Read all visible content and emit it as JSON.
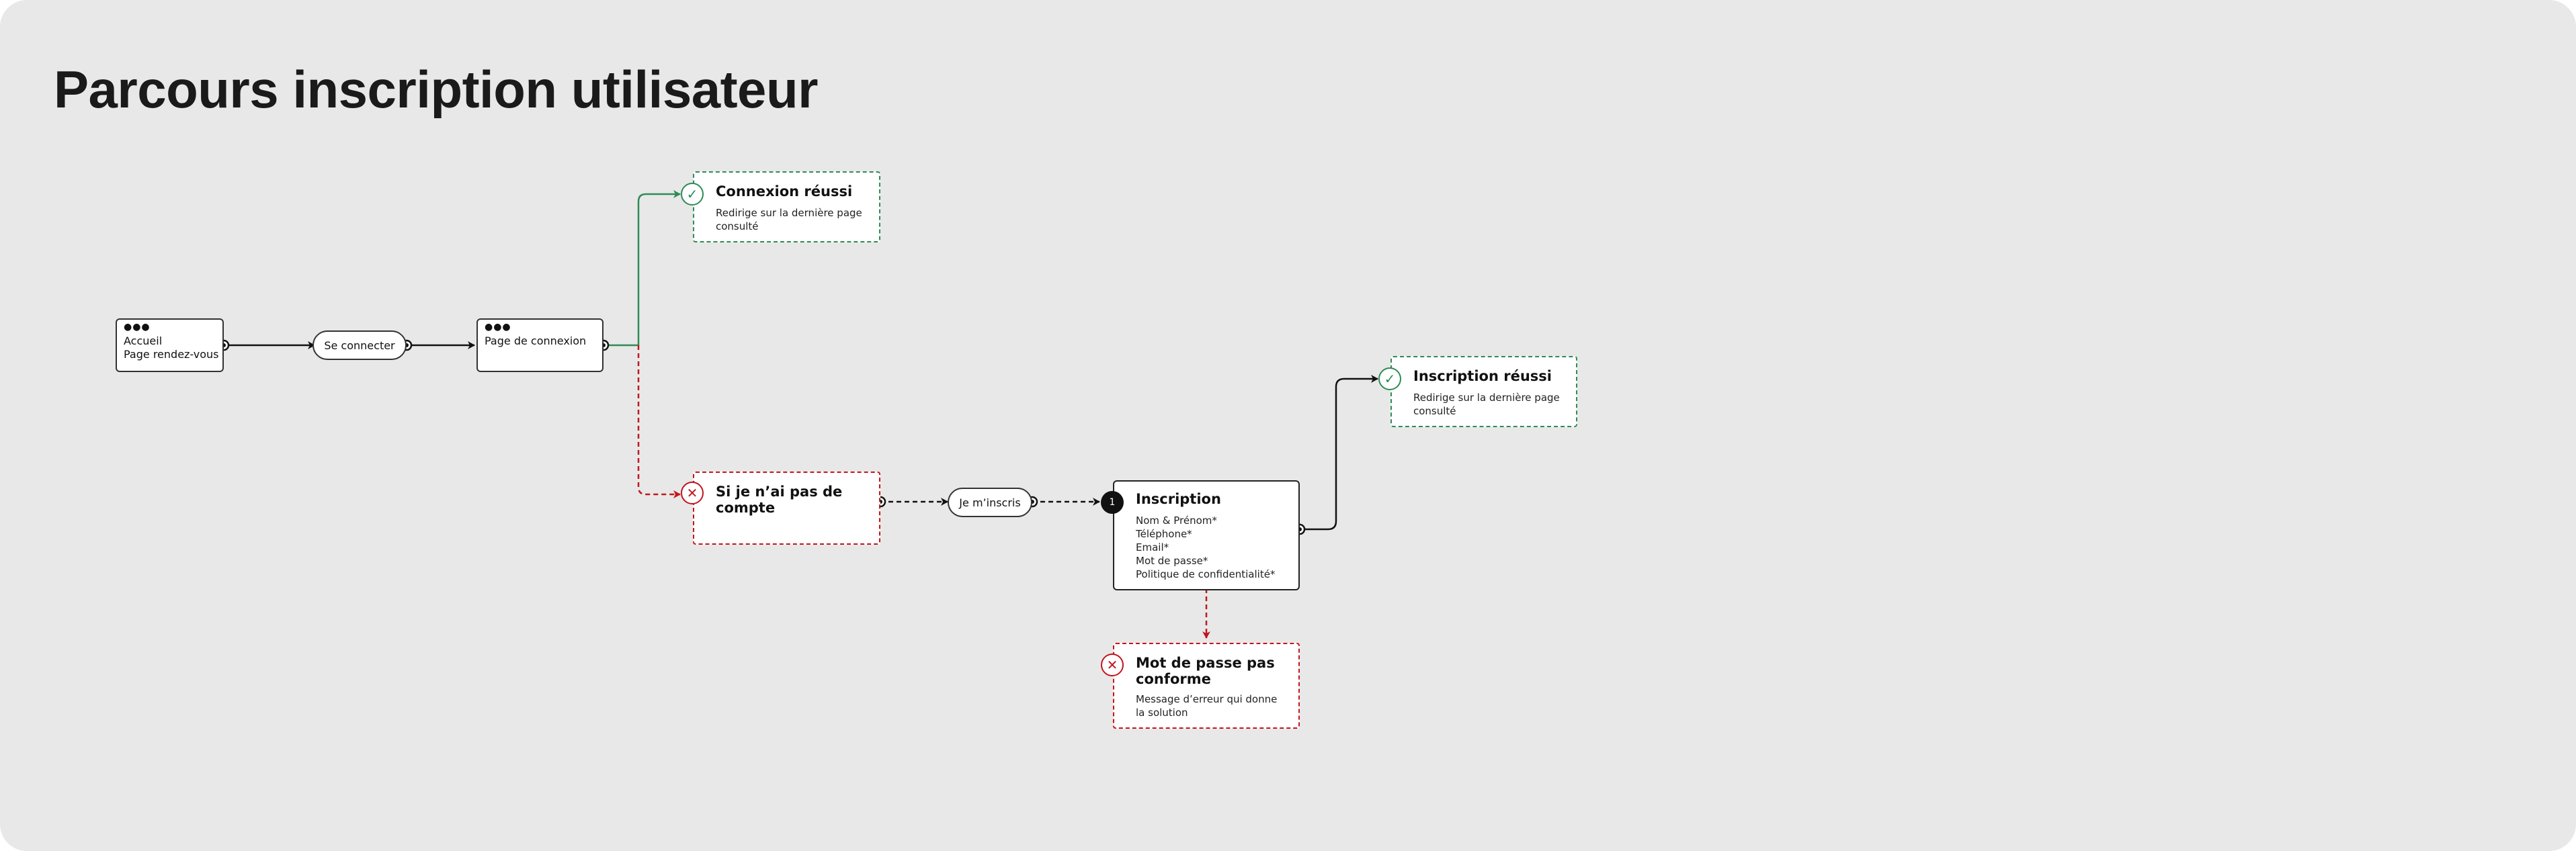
{
  "title": "Parcours inscription utilisateur",
  "nodes": {
    "accueil": {
      "lines": [
        "Accueil",
        "Page rendez-vous"
      ]
    },
    "se_connecter": {
      "label": "Se connecter"
    },
    "page_connexion": {
      "label": "Page de connexion"
    },
    "connexion_reussi": {
      "title": "Connexion réussi",
      "description": "Redirige sur la dernière page consulté"
    },
    "pas_de_compte": {
      "title": "Si je n’ai pas de compte"
    },
    "je_minscris": {
      "label": "Je m’inscris"
    },
    "inscription": {
      "step": "1",
      "title": "Inscription",
      "fields": [
        "Nom & Prénom*",
        "Téléphone*",
        "Email*",
        "Mot de passe*",
        "Politique de confidentialité*"
      ]
    },
    "inscription_reussi": {
      "title": "Inscription réussi",
      "description": "Redirige sur la dernière page consulté"
    },
    "mdp_non_conforme": {
      "title": "Mot de passe pas conforme",
      "description": "Message d’erreur qui donne la solution"
    }
  },
  "icons": {
    "success": "check-circle-icon",
    "error": "x-circle-icon",
    "screen": "window-dots-icon"
  },
  "colors": {
    "success": "#2e8b57",
    "error": "#c0161d",
    "neutral": "#111111",
    "background": "#e8e8e8"
  }
}
